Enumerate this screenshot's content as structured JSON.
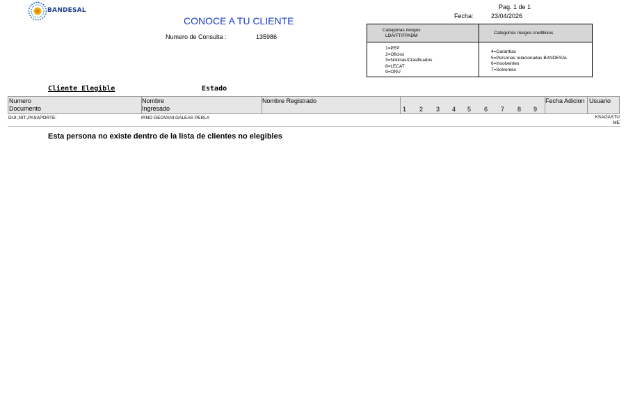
{
  "header": {
    "logo_text": "BANDESAL",
    "title": "CONOCE A TU CLIENTE",
    "page": "Pag. 1 de 1",
    "fecha_label": "Fecha:",
    "fecha_value": "23/04/2026",
    "consulta_label": "Numero de Consulta :",
    "consulta_value": "135986"
  },
  "categories": {
    "left_header_line1": "Categorías riesgos",
    "left_header_line2": "LDA/FT/FPADM",
    "right_header": "Categorías riesgos crediticios",
    "left_items": [
      "1=PEP",
      "2=Oficios",
      "3=Noticias/Clasificados",
      "8=LECAT",
      "9=ONU"
    ],
    "right_items": [
      "4=Garantías",
      "5=Personas relacionadas BANDESAL",
      "6=Insolventes",
      "7=Solventes"
    ]
  },
  "section": {
    "cliente_elegible": "Cliente Elegible",
    "estado": "Estado"
  },
  "table": {
    "col_documento_1": "Numero",
    "col_documento_2": "Documento",
    "col_nombre_1": "Nombre",
    "col_nombre_2": "Ingresado",
    "col_registrado": "Nombre Registrado",
    "risk_columns": [
      "1",
      "2",
      "3",
      "4",
      "5",
      "6",
      "7",
      "8",
      "9"
    ],
    "col_fecha": "Fecha Adicion",
    "col_usuario": "Usuario",
    "row": {
      "documento": "DUI:,NIT:,PASAPORTE:",
      "nombre": "IRNO GEOVANI GALEAS PERLA",
      "usuario_1": "KSAGASTU",
      "usuario_2": "ME"
    }
  },
  "message": "Esta persona no existe dentro de la lista de clientes no elegibles",
  "colors": {
    "title": "#1a3cc8",
    "logo": "#1d3d8c",
    "header_fill": "#d6d6d6"
  },
  "icons": {
    "logo": "bandesal-sun-logo-icon"
  }
}
